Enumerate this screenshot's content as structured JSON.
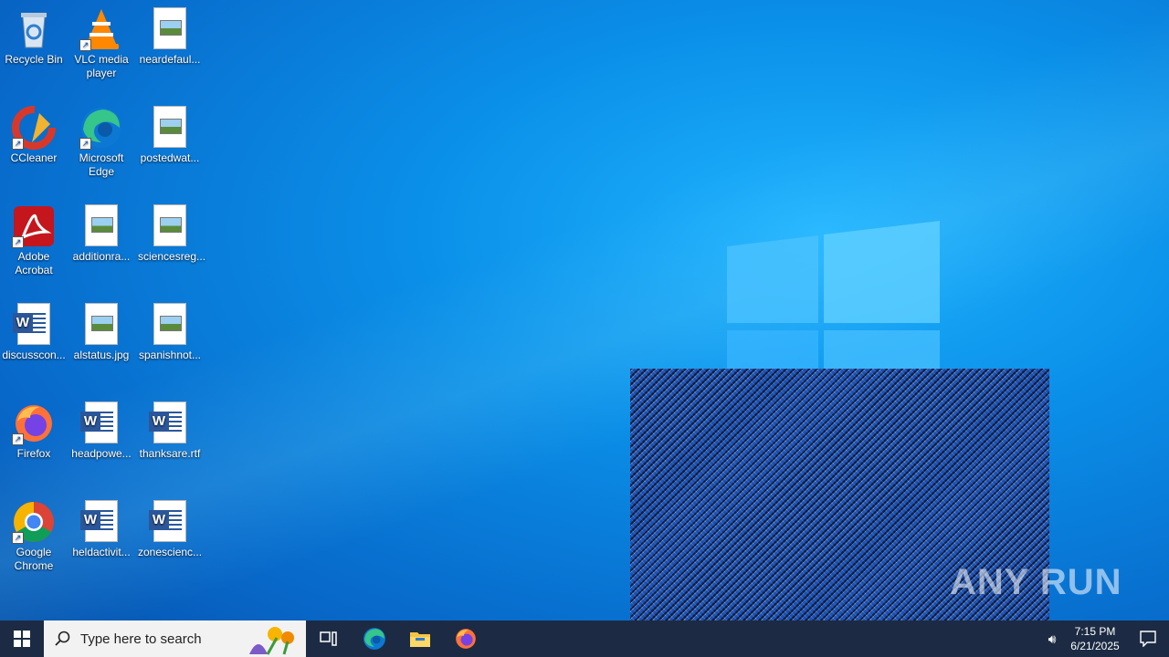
{
  "desktop": {
    "icons": [
      {
        "label": "Recycle Bin",
        "icon": "recycle-bin-icon"
      },
      {
        "label": "VLC media player",
        "icon": "vlc-icon"
      },
      {
        "label": "neardefaul...",
        "icon": "image-file-icon"
      },
      {
        "label": "CCleaner",
        "icon": "ccleaner-icon"
      },
      {
        "label": "Microsoft Edge",
        "icon": "edge-icon"
      },
      {
        "label": "postedwat...",
        "icon": "image-file-icon"
      },
      {
        "label": "Adobe Acrobat",
        "icon": "acrobat-icon"
      },
      {
        "label": "additionra...",
        "icon": "image-file-icon"
      },
      {
        "label": "sciencesreg...",
        "icon": "image-file-icon"
      },
      {
        "label": "discusscon...",
        "icon": "word-doc-icon"
      },
      {
        "label": "alstatus.jpg",
        "icon": "image-file-icon"
      },
      {
        "label": "spanishnot...",
        "icon": "image-file-icon"
      },
      {
        "label": "Firefox",
        "icon": "firefox-icon"
      },
      {
        "label": "headpowe...",
        "icon": "word-doc-icon"
      },
      {
        "label": "thanksare.rtf",
        "icon": "word-doc-icon"
      },
      {
        "label": "Google Chrome",
        "icon": "chrome-icon"
      },
      {
        "label": "heldactivit...",
        "icon": "word-doc-icon"
      },
      {
        "label": "zonescienc...",
        "icon": "word-doc-icon"
      }
    ]
  },
  "watermark": "ANY RUN",
  "taskbar": {
    "search_placeholder": "Type here to search",
    "pinned": [
      "task-view-icon",
      "edge-icon",
      "file-explorer-icon",
      "firefox-icon"
    ],
    "time": "7:15 PM",
    "date": "6/21/2025"
  },
  "colors": {
    "desktop_bg": "#0a8fe8",
    "taskbar_bg": "#1c2b43"
  }
}
